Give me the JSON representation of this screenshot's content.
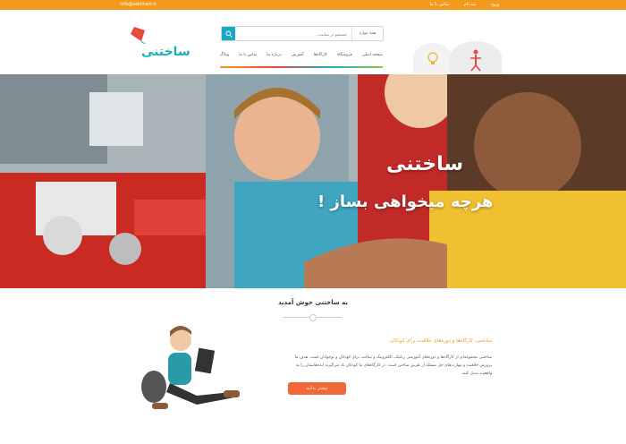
{
  "topbar": {
    "email": "info@sakhtani.ir",
    "links": [
      "ورود",
      "ثبت‌نام",
      "تماس با ما"
    ]
  },
  "header": {
    "logo_text": "ساختنی",
    "search": {
      "placeholder": "جستجو در سایت...",
      "category": "همه موارد"
    },
    "nav": [
      "صفحه اصلی",
      "فروشگاه",
      "کارگاه‌ها",
      "آموزش",
      "درباره ما",
      "تماس با ما",
      "وبلاگ"
    ]
  },
  "hero": {
    "title": "ساختنی",
    "tagline": "هرچه میخواهی بساز !"
  },
  "welcome": {
    "title": "به ساختنی خوش آمدید",
    "intro_title": "ساختنی، کارگاه‌ها و دوره‌های خلاقیت برای کودکان",
    "intro_body": "ساختنی مجموعه‌ای از کارگاه‌ها و دوره‌های آموزشی رباتیک، الکترونیک و ساخت برای کودکان و نوجوانان است. هدف ما پرورش خلاقیت و مهارت‌های حل مسئله از طریق ساختن است. در کارگاه‌های ما کودکان یاد می‌گیرند ایده‌هایشان را به واقعیت تبدیل کنند.",
    "cta": "بیشتر بدانید"
  }
}
